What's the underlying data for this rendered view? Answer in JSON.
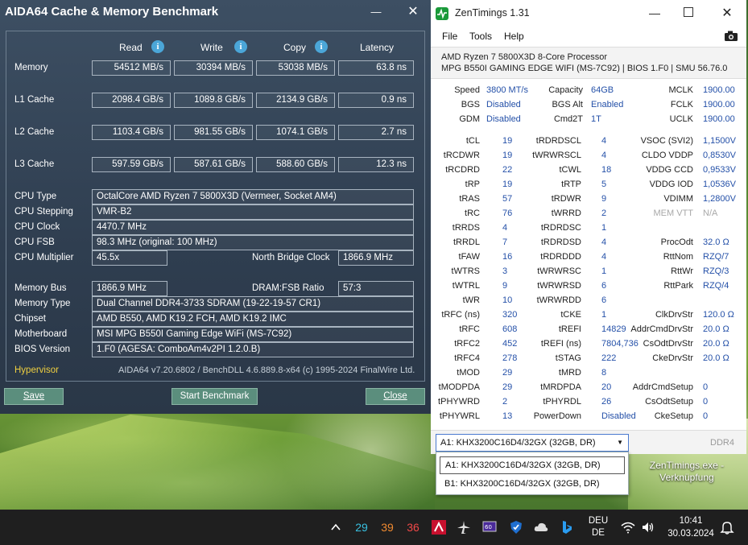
{
  "aida": {
    "title": "AIDA64 Cache & Memory Benchmark",
    "minimize": "—",
    "close": "✕",
    "columns": [
      "Read",
      "Write",
      "Copy",
      "Latency"
    ],
    "bench_rows": [
      {
        "label": "Memory",
        "read": "54512 MB/s",
        "write": "30394 MB/s",
        "copy": "53038 MB/s",
        "latency": "63.8 ns"
      },
      {
        "label": "L1 Cache",
        "read": "2098.4 GB/s",
        "write": "1089.8 GB/s",
        "copy": "2134.9 GB/s",
        "latency": "0.9 ns"
      },
      {
        "label": "L2 Cache",
        "read": "1103.4 GB/s",
        "write": "981.55 GB/s",
        "copy": "1074.1 GB/s",
        "latency": "2.7 ns"
      },
      {
        "label": "L3 Cache",
        "read": "597.59 GB/s",
        "write": "587.61 GB/s",
        "copy": "588.60 GB/s",
        "latency": "12.3 ns"
      }
    ],
    "cpu_type_label": "CPU Type",
    "cpu_type": "OctalCore AMD Ryzen 7 5800X3D  (Vermeer, Socket AM4)",
    "cpu_stepping_label": "CPU Stepping",
    "cpu_stepping": "VMR-B2",
    "cpu_clock_label": "CPU Clock",
    "cpu_clock": "4470.7 MHz",
    "cpu_fsb_label": "CPU FSB",
    "cpu_fsb": "98.3 MHz  (original: 100 MHz)",
    "cpu_mult_label": "CPU Multiplier",
    "cpu_mult": "45.5x",
    "nb_clock_label": "North Bridge Clock",
    "nb_clock": "1866.9 MHz",
    "mem_bus_label": "Memory Bus",
    "mem_bus": "1866.9 MHz",
    "dram_ratio_label": "DRAM:FSB Ratio",
    "dram_ratio": "57:3",
    "mem_type_label": "Memory Type",
    "mem_type": "Dual Channel DDR4-3733 SDRAM  (19-22-19-57 CR1)",
    "chipset_label": "Chipset",
    "chipset": "AMD B550, AMD K19.2 FCH, AMD K19.2 IMC",
    "mobo_label": "Motherboard",
    "mobo": "MSI MPG B550I Gaming Edge WiFi (MS-7C92)",
    "bios_label": "BIOS Version",
    "bios": "1.F0  (AGESA: ComboAm4v2PI 1.2.0.B)",
    "hypervisor": "Hypervisor",
    "version": "AIDA64 v7.20.6802 / BenchDLL 4.6.889.8-x64  (c) 1995-2024 FinalWire Ltd.",
    "save": "Save",
    "start": "Start Benchmark",
    "close_btn": "Close"
  },
  "zen": {
    "title": "ZenTimings 1.31",
    "menu": [
      "File",
      "Tools",
      "Help"
    ],
    "cpu": "AMD Ryzen 7 5800X3D 8-Core Processor",
    "board": "MPG B550I GAMING EDGE WIFI (MS-7C92) | BIOS 1.F0 | SMU 56.76.0",
    "top": [
      {
        "k": "Speed",
        "v": "3800 MT/s"
      },
      {
        "k": "BGS",
        "v": "Disabled"
      },
      {
        "k": "GDM",
        "v": "Disabled"
      }
    ],
    "top_mid": [
      {
        "k": "Capacity",
        "v": "64GB"
      },
      {
        "k": "BGS Alt",
        "v": "Enabled"
      },
      {
        "k": "Cmd2T",
        "v": "1T"
      }
    ],
    "top_right": [
      {
        "k": "MCLK",
        "v": "1900.00"
      },
      {
        "k": "FCLK",
        "v": "1900.00"
      },
      {
        "k": "UCLK",
        "v": "1900.00"
      }
    ],
    "col1": [
      {
        "k": "tCL",
        "v": "19"
      },
      {
        "k": "tRCDWR",
        "v": "19"
      },
      {
        "k": "tRCDRD",
        "v": "22"
      },
      {
        "k": "tRP",
        "v": "19"
      },
      {
        "k": "tRAS",
        "v": "57"
      },
      {
        "k": "tRC",
        "v": "76"
      },
      {
        "k": "tRRDS",
        "v": "4"
      },
      {
        "k": "tRRDL",
        "v": "7"
      },
      {
        "k": "tFAW",
        "v": "16"
      },
      {
        "k": "tWTRS",
        "v": "3"
      },
      {
        "k": "tWTRL",
        "v": "9"
      },
      {
        "k": "tWR",
        "v": "10"
      },
      {
        "k": "tRFC (ns)",
        "v": "320"
      },
      {
        "k": "tRFC",
        "v": "608"
      },
      {
        "k": "tRFC2",
        "v": "452"
      },
      {
        "k": "tRFC4",
        "v": "278"
      },
      {
        "k": "tMOD",
        "v": "29"
      },
      {
        "k": "tMODPDA",
        "v": "29"
      },
      {
        "k": "tPHYWRD",
        "v": "2"
      },
      {
        "k": "tPHYWRL",
        "v": "13"
      }
    ],
    "col2": [
      {
        "k": "tRDRDSCL",
        "v": "4"
      },
      {
        "k": "tWRWRSCL",
        "v": "4"
      },
      {
        "k": "tCWL",
        "v": "18"
      },
      {
        "k": "tRTP",
        "v": "5"
      },
      {
        "k": "tRDWR",
        "v": "9"
      },
      {
        "k": "tWRRD",
        "v": "2"
      },
      {
        "k": "tRDRDSC",
        "v": "1"
      },
      {
        "k": "tRDRDSD",
        "v": "4"
      },
      {
        "k": "tRDRDDD",
        "v": "4"
      },
      {
        "k": "tWRWRSC",
        "v": "1"
      },
      {
        "k": "tWRWRSD",
        "v": "6"
      },
      {
        "k": "tWRWRDD",
        "v": "6"
      },
      {
        "k": "tCKE",
        "v": "1"
      },
      {
        "k": "tREFI",
        "v": "14829"
      },
      {
        "k": "tREFI (ns)",
        "v": "7804,736"
      },
      {
        "k": "tSTAG",
        "v": "222"
      },
      {
        "k": "tMRD",
        "v": "8"
      },
      {
        "k": "tMRDPDA",
        "v": "20"
      },
      {
        "k": "tPHYRDL",
        "v": "26"
      },
      {
        "k": "PowerDown",
        "v": "Disabled"
      }
    ],
    "col3": [
      {
        "k": "VSOC (SVI2)",
        "v": "1,1500V"
      },
      {
        "k": "CLDO VDDP",
        "v": "0,8530V"
      },
      {
        "k": "VDDG CCD",
        "v": "0,9533V"
      },
      {
        "k": "VDDG IOD",
        "v": "1,0536V"
      },
      {
        "k": "VDIMM",
        "v": "1,2800V"
      },
      {
        "k": "MEM VTT",
        "v": "N/A"
      },
      {
        "k": "",
        "v": ""
      },
      {
        "k": "ProcOdt",
        "v": "32.0 Ω"
      },
      {
        "k": "RttNom",
        "v": "RZQ/7"
      },
      {
        "k": "RttWr",
        "v": "RZQ/3"
      },
      {
        "k": "RttPark",
        "v": "RZQ/4"
      },
      {
        "k": "",
        "v": ""
      },
      {
        "k": "ClkDrvStr",
        "v": "120.0 Ω"
      },
      {
        "k": "AddrCmdDrvStr",
        "v": "20.0 Ω"
      },
      {
        "k": "CsOdtDrvStr",
        "v": "20.0 Ω"
      },
      {
        "k": "CkeDrvStr",
        "v": "20.0 Ω"
      },
      {
        "k": "",
        "v": ""
      },
      {
        "k": "AddrCmdSetup",
        "v": "0"
      },
      {
        "k": "CsOdtSetup",
        "v": "0"
      },
      {
        "k": "CkeSetup",
        "v": "0"
      }
    ],
    "dimm_selected": "A1: KHX3200C16D4/32GX (32GB, DR)",
    "dimm_options": [
      "A1: KHX3200C16D4/32GX (32GB, DR)",
      "B1: KHX3200C16D4/32GX (32GB, DR)"
    ],
    "mem_type": "DDR4"
  },
  "desktop": {
    "shortcut": "ZenTimings.exe - Verknüpfung"
  },
  "taskbar": {
    "temps": [
      {
        "v": "29",
        "color": "#38c0e0"
      },
      {
        "v": "39",
        "color": "#f08a30"
      },
      {
        "v": "36",
        "color": "#f04848"
      }
    ],
    "lang1": "DEU",
    "lang2": "DE",
    "time": "10:41",
    "date": "30.03.2024"
  }
}
